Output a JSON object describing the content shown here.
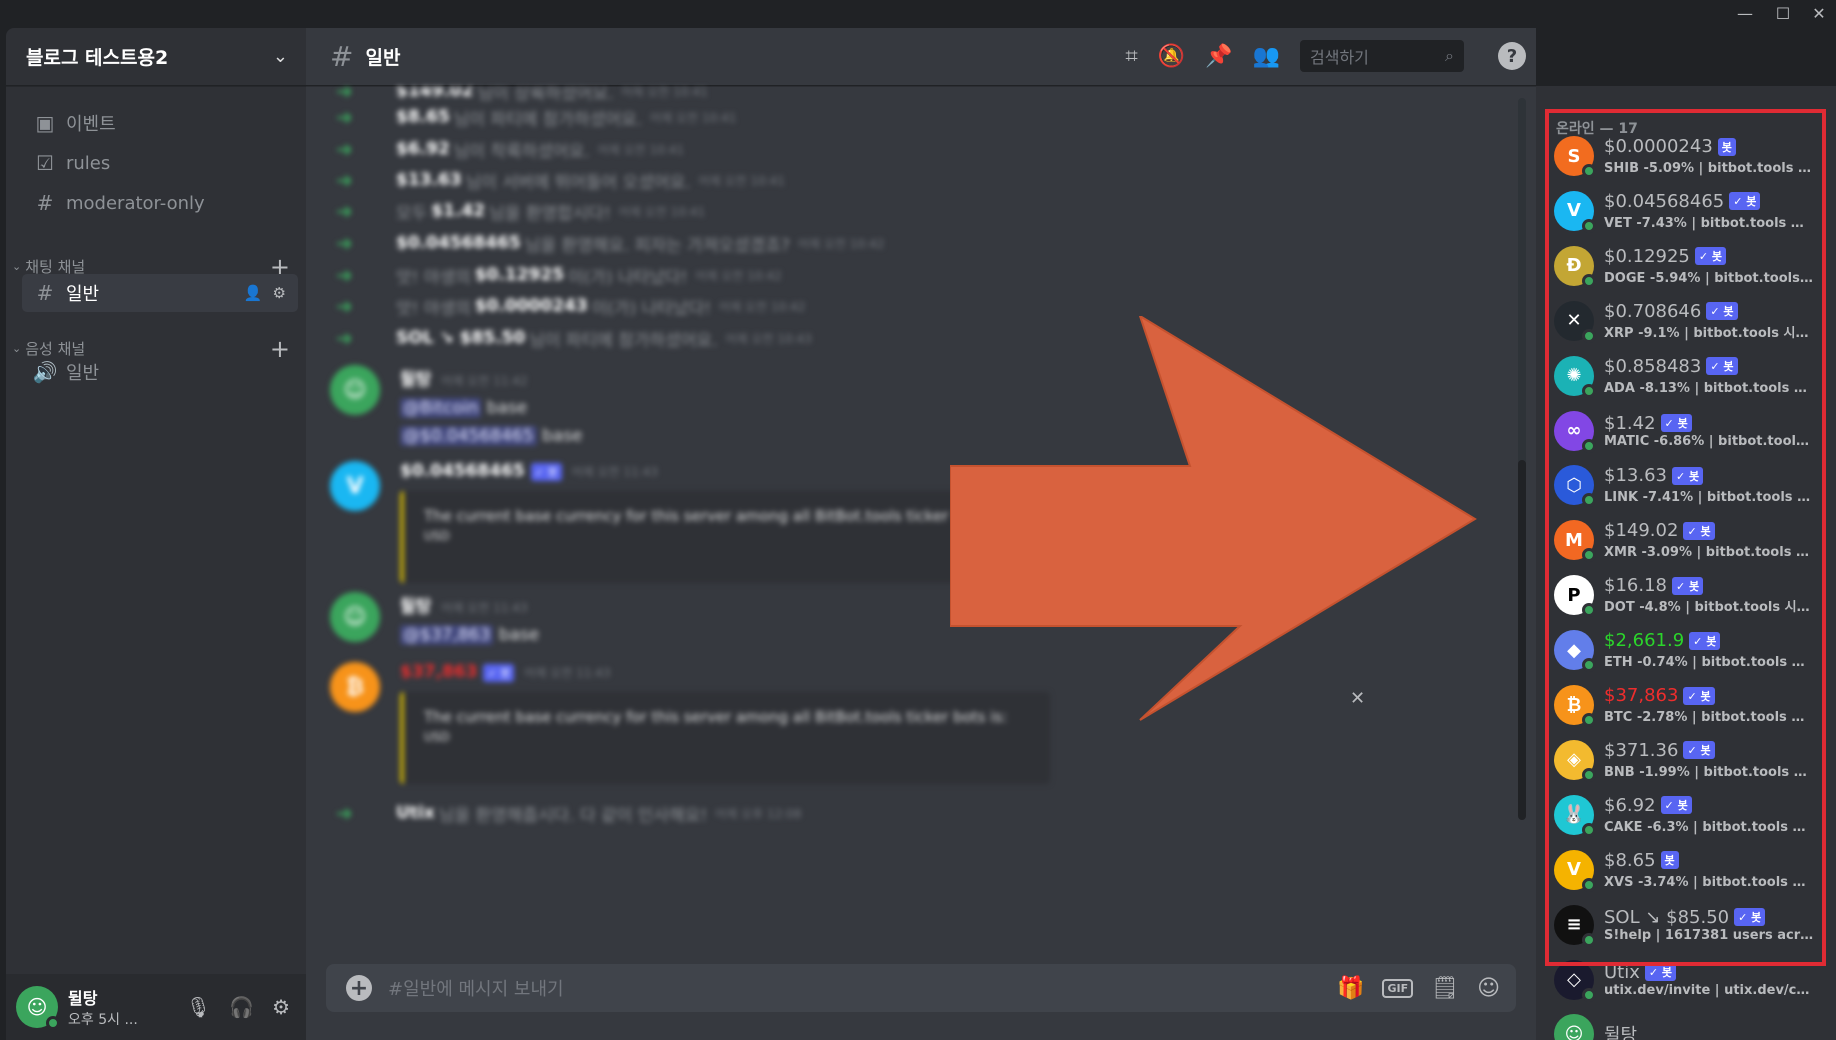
{
  "window": {
    "minimize": "—",
    "maximize": "☐",
    "close": "✕"
  },
  "sidebar": {
    "server_name": "블로그 테스트용2",
    "top_channels": [
      {
        "label": "이벤트",
        "icon": "calendar-icon"
      },
      {
        "label": "rules",
        "icon": "checkbox-icon"
      },
      {
        "label": "moderator-only",
        "icon": "hash-lock-icon"
      }
    ],
    "text_category": "채팅 채널",
    "text_channels": [
      {
        "label": "일반",
        "active": true
      }
    ],
    "voice_category": "음성 채널",
    "voice_channels": [
      {
        "label": "일반"
      }
    ]
  },
  "user": {
    "name": "뒬탕",
    "status": "오후 5시 ..."
  },
  "header": {
    "channel": "일반",
    "search_placeholder": "검색하기"
  },
  "messages": {
    "system": [
      {
        "prefix": "",
        "name": "$149.02",
        "text": "님이 상륙하셨어요.",
        "ts": "어제 오전 10:41"
      },
      {
        "prefix": "",
        "name": "$8.65",
        "text": "님이 파티에 참가하셨어요.",
        "ts": "어제 오전 10:41"
      },
      {
        "prefix": "",
        "name": "$6.92",
        "text": "님이 착륙하셨어요.",
        "ts": "어제 오전 10:41"
      },
      {
        "prefix": "",
        "name": "$13.63",
        "text": "님이 서버에 뛰어들어 오셨어요.",
        "ts": "어제 오전 10:41"
      },
      {
        "prefix": "모두",
        "name": "$1.42",
        "text": "님을 환영합시다!",
        "ts": "어제 오전 10:41"
      },
      {
        "prefix": "",
        "name": "$0.04568465",
        "text": "님을 환영해요. 피자는 가져오셨겠죠?",
        "ts": "어제 오전 10:42"
      },
      {
        "prefix": "앗! 야생의",
        "name": "$0.12925",
        "text": "이(가) 나타났다!",
        "ts": "어제 오전 10:42"
      },
      {
        "prefix": "앗! 야생의",
        "name": "$0.0000243",
        "text": "이(가) 나타났다!",
        "ts": "어제 오전 10:42"
      },
      {
        "prefix": "",
        "name": "SOL ↘ $85.50",
        "text": "님이 파티에 참가하셨어요.",
        "ts": "어제 오전 10:43"
      }
    ],
    "m1": {
      "name": "뒬탕",
      "ts": "어제 오전 11:42",
      "mention1": "@Bitcoin",
      "text1": "base",
      "mention2": "@$0.04568465",
      "text2": "base"
    },
    "m2": {
      "name": "$0.04568465",
      "badge": "✓ 봇",
      "ts": "어제 오전 11:43",
      "embed": "The current base currency for this server among all BitBot.tools ticker bots is:",
      "embed_value": "USD"
    },
    "m3": {
      "name": "뒬탕",
      "ts": "어제 오전 11:43",
      "mention": "@$37,863",
      "text": "base"
    },
    "m4": {
      "name": "$37,863",
      "badge": "✓ 봇",
      "ts": "어제 오전 11:43",
      "embed": "The current base currency for this server among all BitBot.tools ticker bots is:",
      "embed_value": "USD"
    },
    "last": {
      "name": "Utix",
      "text": "님을 환영해줍시다. 다 같이 인사해요!",
      "ts": "어제 오후 12:08"
    }
  },
  "composer": {
    "placeholder": "#일반에 메시지 보내기",
    "gif": "GIF"
  },
  "members": {
    "header": "온라인 — 17",
    "list": [
      {
        "name": "$0.0000243",
        "bot": "봇",
        "status": "SHIB -5.09% | bitbot.tools 시...",
        "color": "#f26c1f",
        "glyph": "S"
      },
      {
        "name": "$0.04568465",
        "bot": "✓ 봇",
        "status": "VET -7.43% | bitbot.tools 시...",
        "color": "#1ab7f2",
        "glyph": "V"
      },
      {
        "name": "$0.12925",
        "bot": "✓ 봇",
        "status": "DOGE -5.94% | bitbot.tools 시...",
        "color": "#c3a634",
        "glyph": "Ð"
      },
      {
        "name": "$0.708646",
        "bot": "✓ 봇",
        "status": "XRP -9.1% | bitbot.tools 시청 중",
        "color": "#23292f",
        "glyph": "✕"
      },
      {
        "name": "$0.858483",
        "bot": "✓ 봇",
        "status": "ADA -8.13% | bitbot.tools 시...",
        "color": "#1bb2b5",
        "glyph": "✺"
      },
      {
        "name": "$1.42",
        "bot": "✓ 봇",
        "status": "MATIC -6.86% | bitbot.tools ...",
        "color": "#8247e5",
        "glyph": "∞"
      },
      {
        "name": "$13.63",
        "bot": "✓ 봇",
        "status": "LINK -7.41% | bitbot.tools 시...",
        "color": "#2a5ada",
        "glyph": "⬡"
      },
      {
        "name": "$149.02",
        "bot": "✓ 봇",
        "status": "XMR -3.09% | bitbot.tools 시...",
        "color": "#f26822",
        "glyph": "M"
      },
      {
        "name": "$16.18",
        "bot": "✓ 봇",
        "status": "DOT -4.8% | bitbot.tools 시청...",
        "color": "#ffffff",
        "glyph": "P"
      },
      {
        "name": "$2,661.9",
        "bot": "✓ 봇",
        "status": "ETH -0.74% | bitbot.tools 시...",
        "color": "#627eea",
        "glyph": "◆",
        "name_color": "#2bd52b"
      },
      {
        "name": "$37,863",
        "bot": "✓ 봇",
        "status": "BTC -2.78% | bitbot.tools 시...",
        "color": "#f7931a",
        "glyph": "₿",
        "name_color": "#ed2d2d"
      },
      {
        "name": "$371.36",
        "bot": "✓ 봇",
        "status": "BNB -1.99% | bitbot.tools 시청...",
        "color": "#f3ba2f",
        "glyph": "◈"
      },
      {
        "name": "$6.92",
        "bot": "✓ 봇",
        "status": "CAKE -6.3% | bitbot.tools 시...",
        "color": "#1fc7d4",
        "glyph": "🐰"
      },
      {
        "name": "$8.65",
        "bot": "봇",
        "status": "XVS -3.74% | bitbot.tools 시...",
        "color": "#f5b300",
        "glyph": "V"
      },
      {
        "name": "SOL ↘ $85.50",
        "bot": "✓ 봇",
        "status": "S!help | 1617381 users across ...",
        "color": "#111111",
        "glyph": "≡"
      },
      {
        "name": "Utix",
        "bot": "✓ 봇",
        "status": "utix.dev/invite | utix.dev/com...",
        "color": "#1a1a2e",
        "glyph": "◇"
      },
      {
        "name": "뒬탕",
        "bot": "",
        "status": "",
        "color": "#3ba55d",
        "glyph": "☺"
      }
    ]
  }
}
